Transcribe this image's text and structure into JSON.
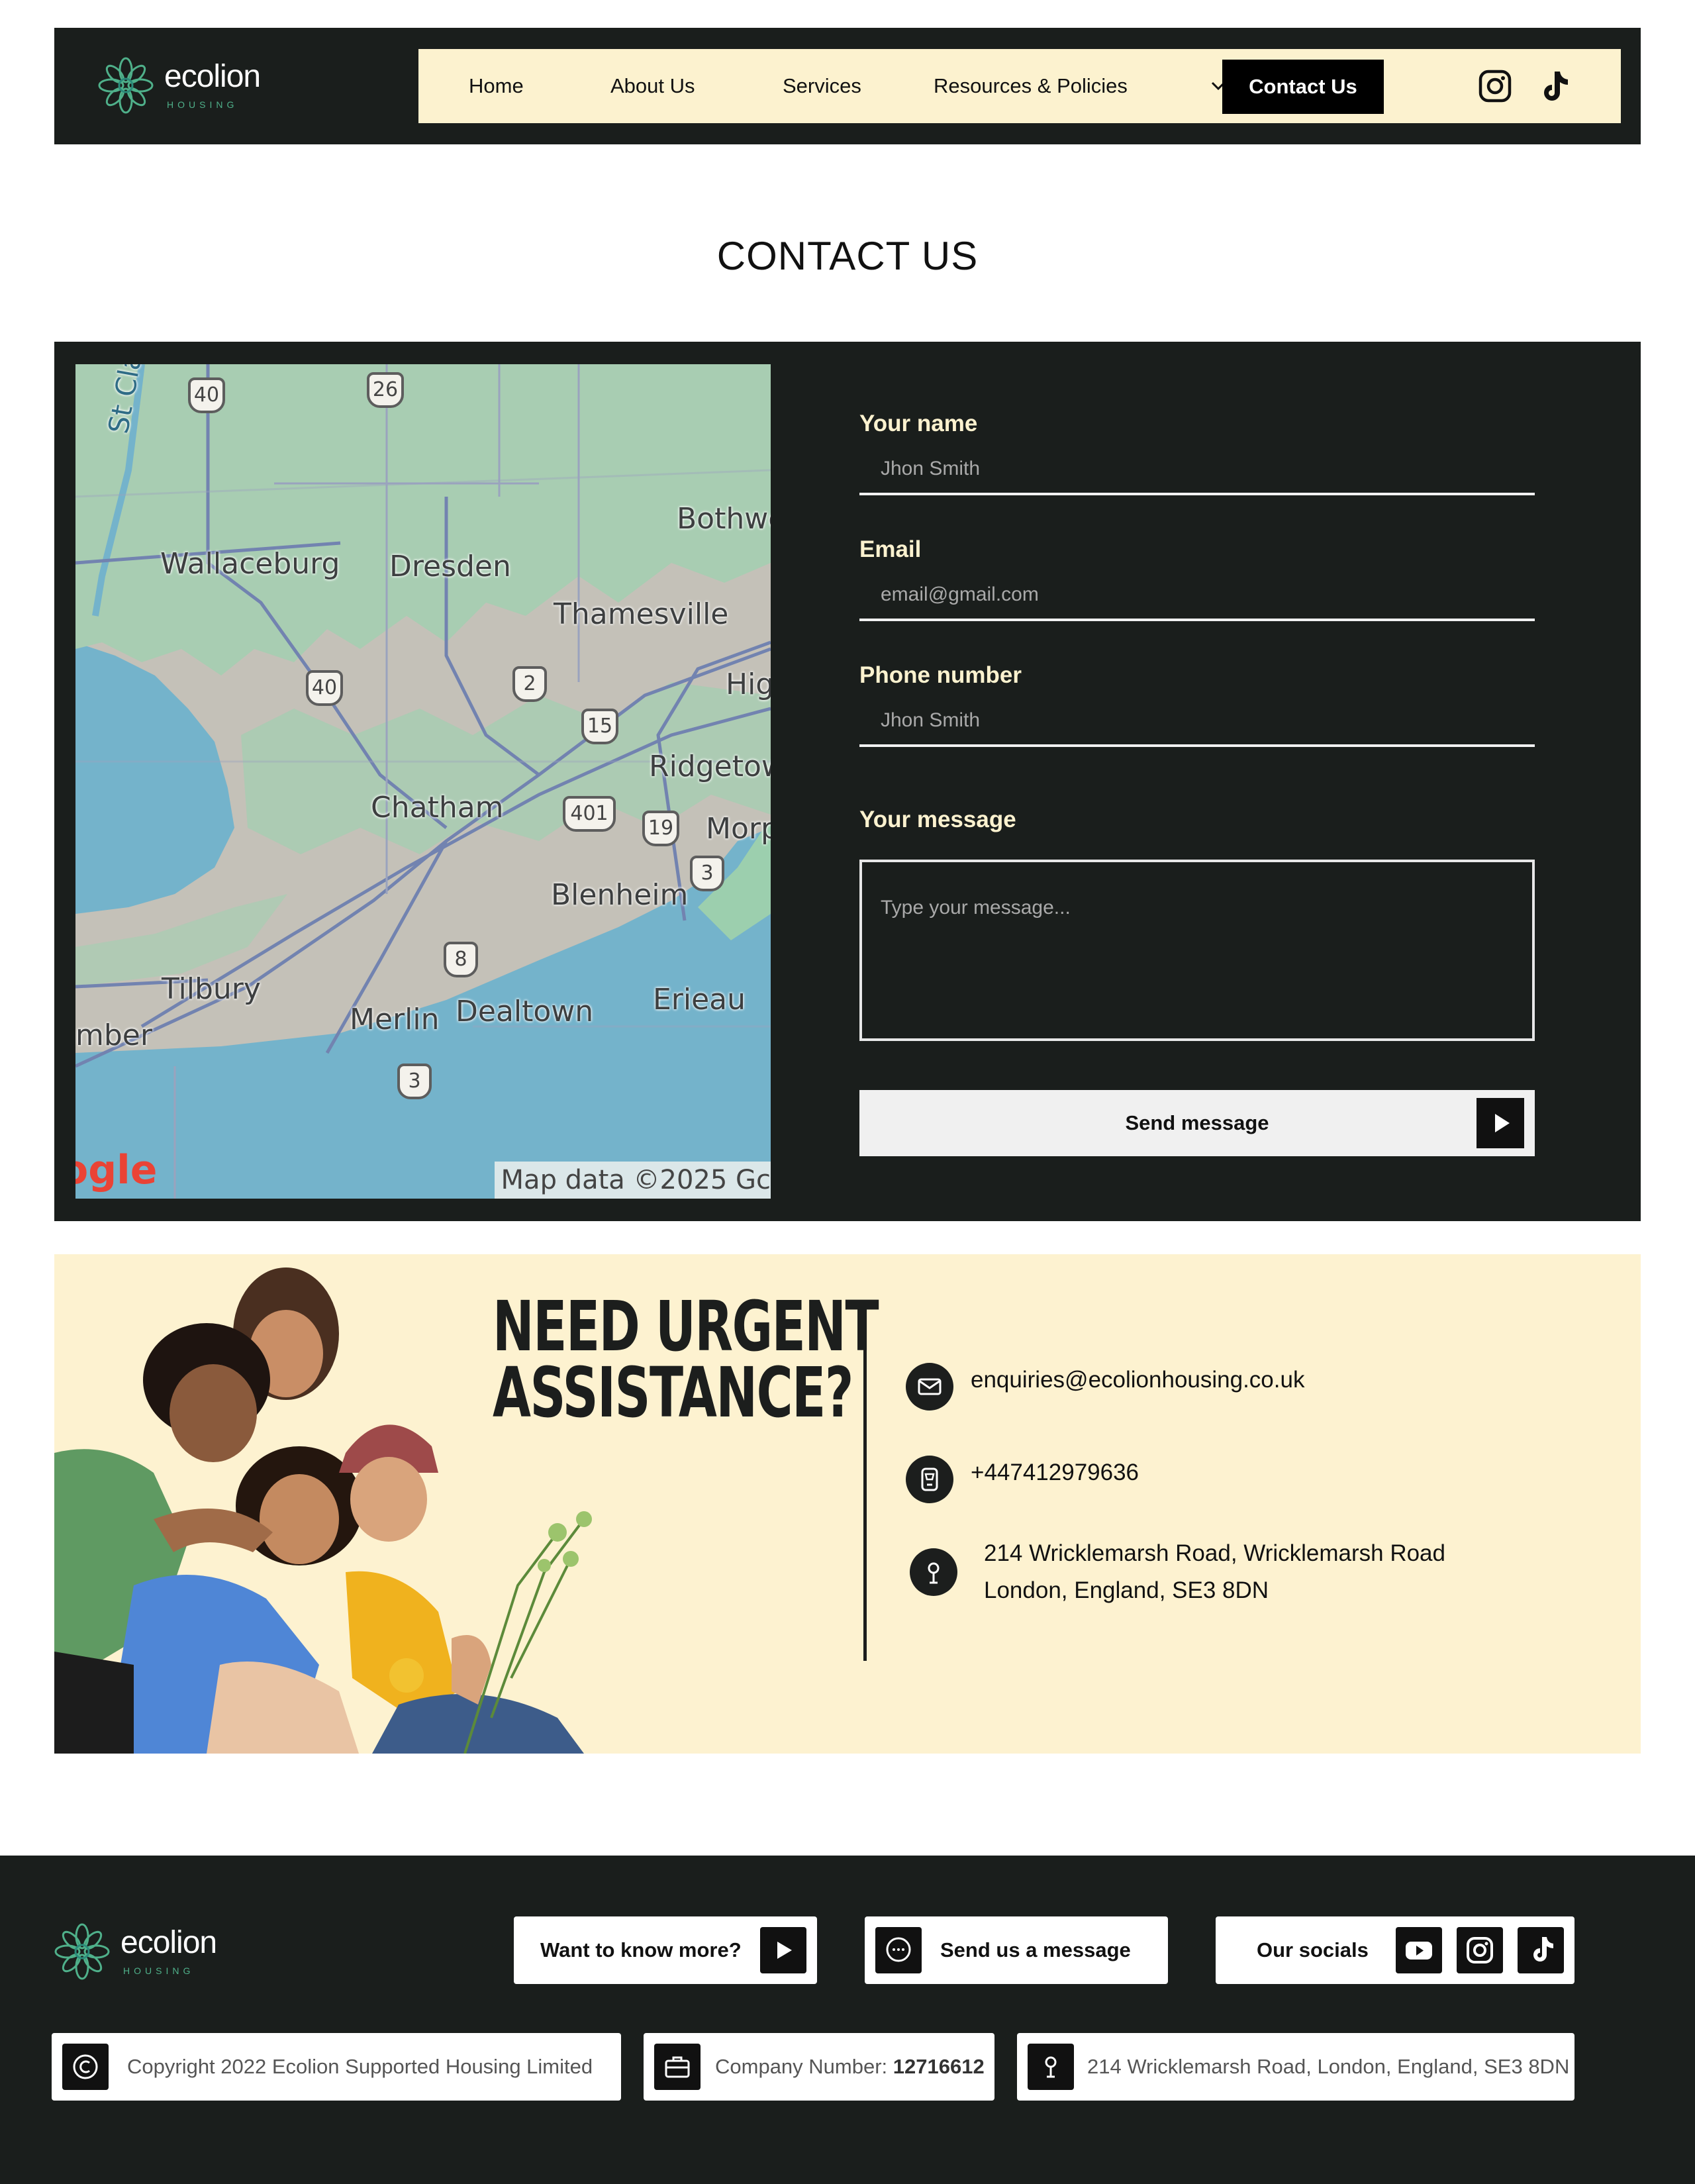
{
  "brand": {
    "name": "ecolion",
    "tagline": "HOUSING"
  },
  "nav": {
    "items": [
      "Home",
      "About Us",
      "Services",
      "Resources & Policies"
    ],
    "cta": "Contact Us"
  },
  "page_title": "CONTACT US",
  "map": {
    "labels": [
      "Wallaceburg",
      "Dresden",
      "Bothwe",
      "Thamesville",
      "Hig",
      "Ridgetow",
      "Chatham",
      "Morp",
      "Blenheim",
      "Tilbury",
      "Merlin",
      "Dealtown",
      "Erieau",
      "mber",
      "St Clair Riv"
    ],
    "routes": [
      "40",
      "26",
      "40",
      "2",
      "15",
      "401",
      "19",
      "3",
      "8",
      "3"
    ],
    "credit": "Map data ©2025 Gc",
    "logo_text": "ogle"
  },
  "form": {
    "name_label": "Your name",
    "name_placeholder": "Jhon Smith",
    "email_label": "Email",
    "email_placeholder": "email@gmail.com",
    "phone_label": "Phone number",
    "phone_placeholder": "Jhon Smith",
    "message_label": "Your message",
    "message_placeholder": "Type your message...",
    "submit_label": "Send message"
  },
  "urgent": {
    "title_line1": "NEED URGENT",
    "title_line2": "ASSISTANCE?",
    "email": "enquiries@ecolionhousing.co.uk",
    "phone": "+447412979636",
    "address_line1": "214 Wricklemarsh Road, Wricklemarsh Road",
    "address_line2": "London, England, SE3 8DN"
  },
  "footer": {
    "more_label": "Want to know more?",
    "message_label": "Send us a message",
    "socials_label": "Our socials",
    "copyright": "Copyright 2022 Ecolion Supported Housing Limited",
    "company_prefix": "Company Number: ",
    "company_number": "12716612",
    "address": "214 Wricklemarsh Road, London, England, SE3 8DN"
  },
  "colors": {
    "dark": "#1a1e1c",
    "cream": "#fcf2cf",
    "accent_green": "#4fb08a",
    "water": "#74b3cb"
  },
  "icons": [
    "logo-flower-icon",
    "chevron-down-icon",
    "instagram-icon",
    "tiktok-icon",
    "play-arrow-icon",
    "mail-icon",
    "phone-icon",
    "location-pin-icon",
    "chat-bubble-icon",
    "youtube-icon",
    "copyright-icon",
    "briefcase-icon"
  ]
}
